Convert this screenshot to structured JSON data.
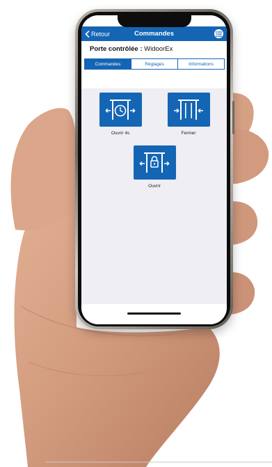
{
  "navbar": {
    "back_label": "Retour",
    "title": "Commandes",
    "menu_icon": "list-icon"
  },
  "header": {
    "label": "Porte contrôlée :",
    "door_name": "WidoorEx"
  },
  "tabs": [
    {
      "label": "Commandes",
      "active": true
    },
    {
      "label": "Réglages",
      "active": false
    },
    {
      "label": "Informations",
      "active": false
    }
  ],
  "commands": [
    {
      "label": "Ouvrir 4s",
      "icon": "door-open-timer-icon"
    },
    {
      "label": "Fermer",
      "icon": "door-close-icon"
    },
    {
      "label": "Ouvrir",
      "icon": "door-open-lock-icon"
    }
  ],
  "colors": {
    "accent": "#1565b5",
    "content_background": "#eeeef3"
  }
}
